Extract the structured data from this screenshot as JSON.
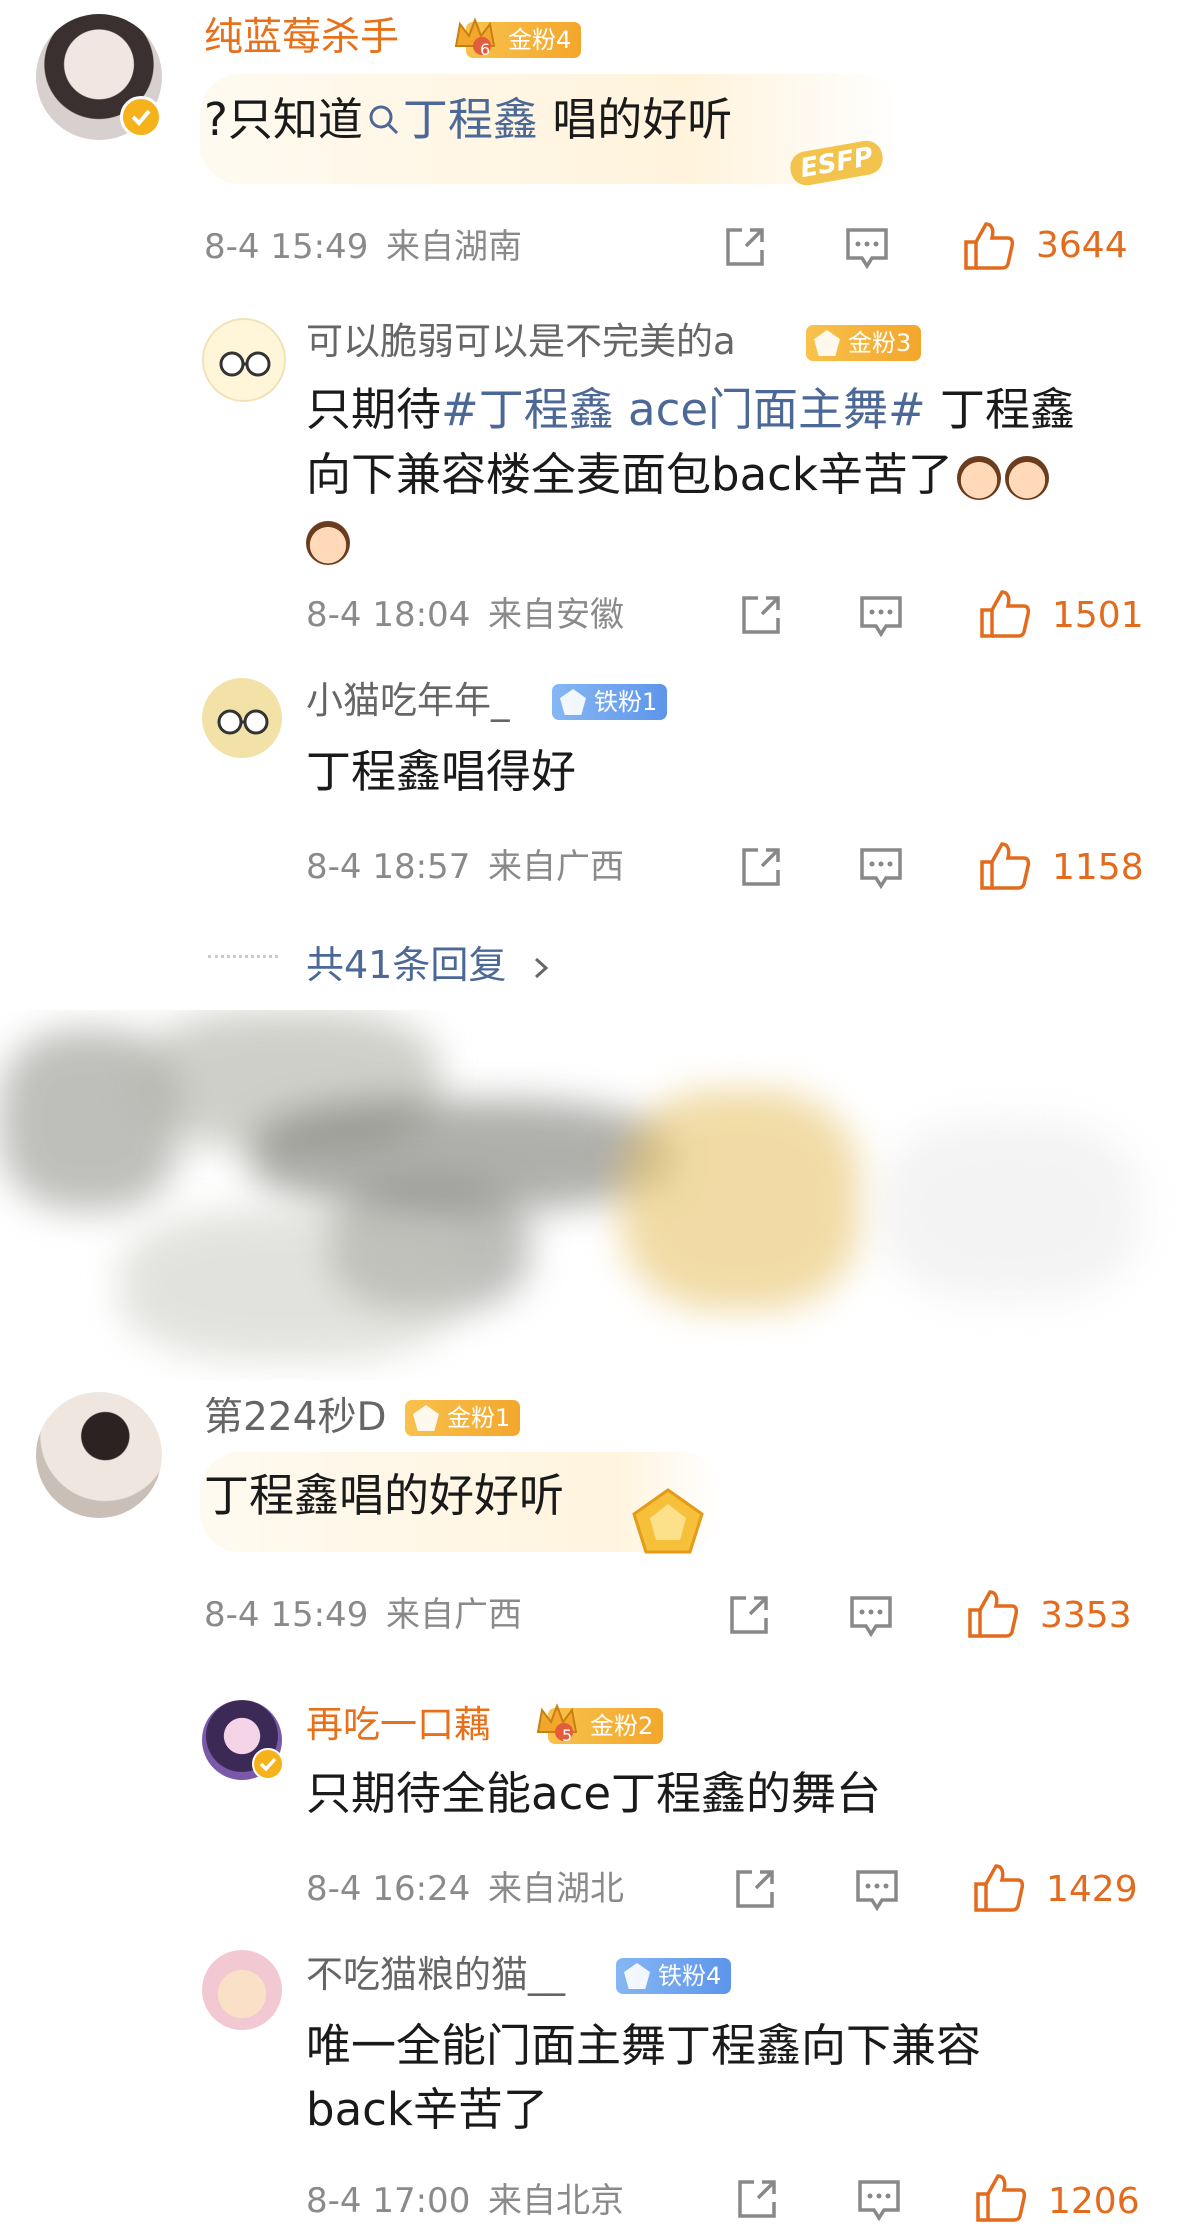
{
  "comments": [
    {
      "name": "纯蓝莓杀手",
      "badge": "金粉4",
      "crown_level": "6",
      "text_prefix": "?只知道",
      "topic": "丁程鑫",
      "text_suffix": " 唱的好听",
      "card_tag": "ESFP",
      "time": "8-4 15:49",
      "location": "来自湖南",
      "likes": "3644"
    },
    {
      "name": "第224秒D",
      "badge": "金粉1",
      "text": "丁程鑫唱的好好听",
      "time": "8-4 15:49",
      "location": "来自广西",
      "likes": "3353"
    }
  ],
  "replies_a": [
    {
      "name": "可以脆弱可以是不完美的a",
      "badge": "金粉3",
      "line1_prefix": "只期待",
      "hashtag": "#丁程鑫 ace门面主舞#",
      "line1_suffix": " 丁程鑫",
      "line2": "向下兼容楼全麦面包back辛苦了",
      "time": "8-4 18:04",
      "location": "来自安徽",
      "likes": "1501"
    },
    {
      "name": "小猫吃年年_",
      "badge": "铁粉1",
      "text": "丁程鑫唱得好",
      "time": "8-4 18:57",
      "location": "来自广西",
      "likes": "1158"
    }
  ],
  "more_replies": "共41条回复",
  "replies_b": [
    {
      "name": "再吃一口藕",
      "badge": "金粉2",
      "crown_level": "5",
      "text": "只期待全能ace丁程鑫的舞台",
      "time": "8-4 16:24",
      "location": "来自湖北",
      "likes": "1429"
    },
    {
      "name": "不吃猫粮的猫__",
      "badge": "铁粉4",
      "line1": "唯一全能门面主舞丁程鑫向下兼容",
      "line2": "back辛苦了",
      "time": "8-4 17:00",
      "location": "来自北京",
      "likes": "1206"
    }
  ],
  "colors": {
    "accent": "#e26b1d",
    "link": "#4c6897",
    "vip_name": "#e8701a",
    "gold_badge": "#f3a62c",
    "iron_badge": "#5d95ea"
  },
  "icons": [
    "search-icon",
    "share-icon",
    "comment-icon",
    "like-icon",
    "chevron-right-icon",
    "verified-icon"
  ]
}
